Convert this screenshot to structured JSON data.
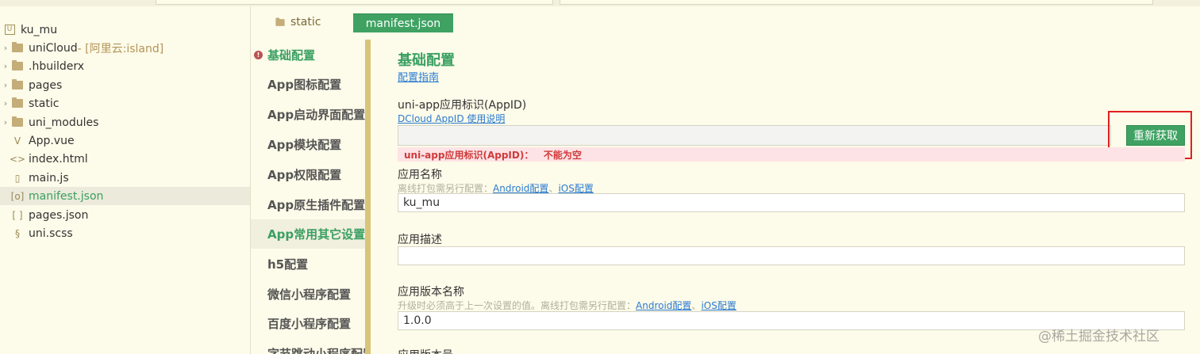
{
  "sidebar": {
    "root": "ku_mu",
    "items": [
      {
        "label": "uniCloud",
        "suffix": " - [阿里云:island]",
        "type": "folder-cloud",
        "expandable": true
      },
      {
        "label": ".hbuilderx",
        "type": "folder",
        "expandable": true
      },
      {
        "label": "pages",
        "type": "folder",
        "expandable": true
      },
      {
        "label": "static",
        "type": "folder",
        "expandable": true
      },
      {
        "label": "uni_modules",
        "type": "folder",
        "expandable": true
      },
      {
        "label": "App.vue",
        "type": "vue-file",
        "icon": "V"
      },
      {
        "label": "index.html",
        "type": "html-file",
        "icon": "<>"
      },
      {
        "label": "main.js",
        "type": "js-file",
        "icon": "▯"
      },
      {
        "label": "manifest.json",
        "type": "json-file",
        "icon": "[o]",
        "selected": true
      },
      {
        "label": "pages.json",
        "type": "json-file",
        "icon": "[ ]"
      },
      {
        "label": "uni.scss",
        "type": "scss-file",
        "icon": "§"
      }
    ]
  },
  "tabs": {
    "folder": "static",
    "active": "manifest.json"
  },
  "confnav": {
    "items": [
      "基础配置",
      "App图标配置",
      "App启动界面配置",
      "App模块配置",
      "App权限配置",
      "App原生插件配置",
      "App常用其它设置",
      "h5配置",
      "微信小程序配置",
      "百度小程序配置",
      "字节跳动小程序配置"
    ]
  },
  "main": {
    "section_title": "基础配置",
    "guide_link": "配置指南",
    "appid_label": "uni-app应用标识(AppID)",
    "appid_help_link": "DCloud AppID 使用说明",
    "appid_value": "",
    "refresh_button": "重新获取",
    "appid_error": "uni-app应用标识(AppID)：   不能为空",
    "name_label": "应用名称",
    "name_hint": "离线打包需另行配置：",
    "android_link": "Android配置",
    "separator": "、",
    "ios_link": "iOS配置",
    "name_value": "ku_mu",
    "desc_label": "应用描述",
    "desc_value": "",
    "version_label": "应用版本名称",
    "version_hint": "升级时必须高于上一次设置的值。离线打包需另行配置：",
    "version_value": "1.0.0",
    "next_label": "应用版本号"
  },
  "watermark": "@稀土掘金技术社区",
  "colors": {
    "accent": "#3fa263",
    "error": "#d03a3a",
    "highlight": "#e02020"
  }
}
